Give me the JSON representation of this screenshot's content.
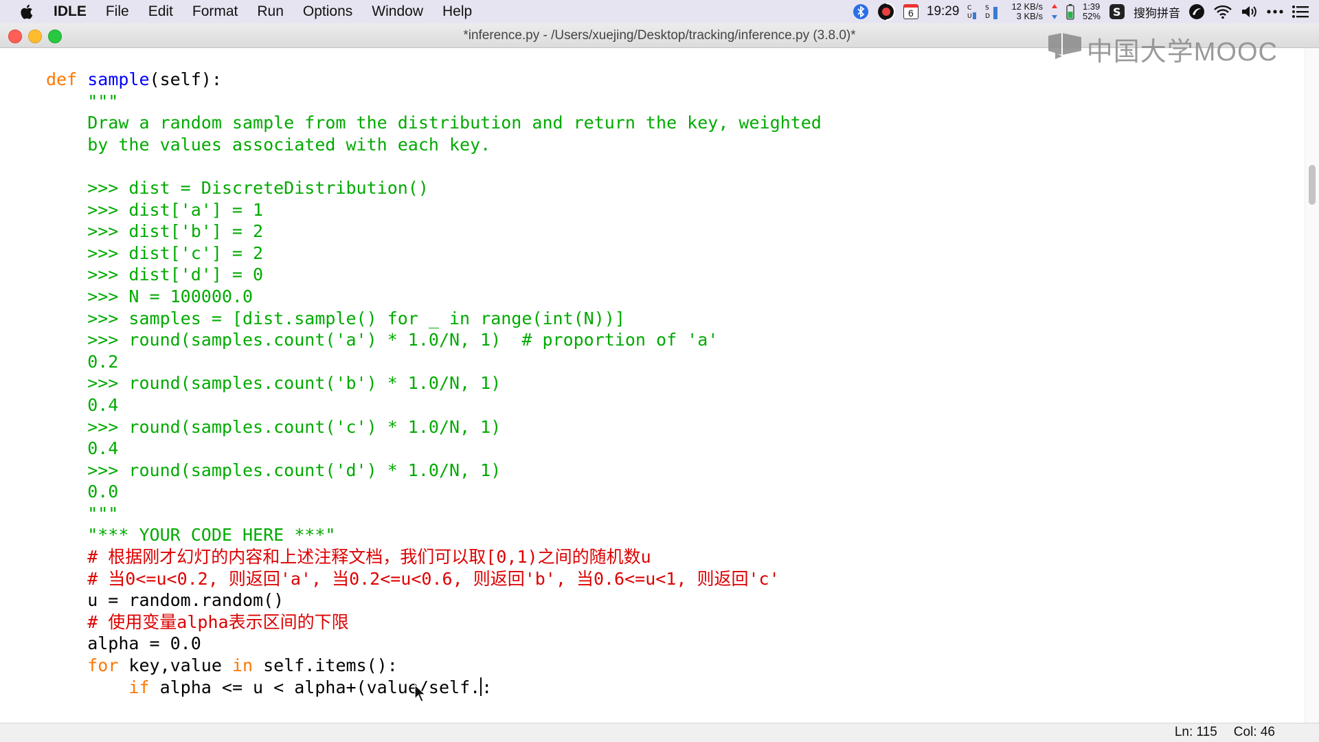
{
  "menubar": {
    "app_name": "IDLE",
    "items": [
      "File",
      "Edit",
      "Format",
      "Run",
      "Options",
      "Window",
      "Help"
    ],
    "status": {
      "calendar_day": "6",
      "time": "19:29",
      "net_up": "12 KB/s",
      "net_down": "3 KB/s",
      "battery_time": "1:39",
      "battery_percent": "52%",
      "input_method": "搜狗拼音",
      "icons": [
        "bluetooth-icon",
        "app-icon",
        "calendar-icon",
        "cpu-meter-icon",
        "disk-meter-icon",
        "battery-icon",
        "sogou-icon",
        "app2-icon",
        "wifi-icon",
        "volume-icon",
        "more-icon",
        "control-center-icon"
      ]
    }
  },
  "window": {
    "title": "*inference.py - /Users/xuejing/Desktop/tracking/inference.py (3.8.0)*"
  },
  "watermark": {
    "text": "中国大学MOOC"
  },
  "code": {
    "lines": [
      [
        {
          "t": "def ",
          "c": "kw"
        },
        {
          "t": "sample",
          "c": "def"
        },
        {
          "t": "(self):",
          "c": ""
        }
      ],
      [
        {
          "t": "    \"\"\"",
          "c": "str"
        }
      ],
      [
        {
          "t": "    Draw a random sample from the distribution and return the key, weighted",
          "c": "str"
        }
      ],
      [
        {
          "t": "    by the values associated with each key.",
          "c": "str"
        }
      ],
      [
        {
          "t": "",
          "c": "str"
        }
      ],
      [
        {
          "t": "    >>> dist = DiscreteDistribution()",
          "c": "str"
        }
      ],
      [
        {
          "t": "    >>> dist['a'] = 1",
          "c": "str"
        }
      ],
      [
        {
          "t": "    >>> dist['b'] = 2",
          "c": "str"
        }
      ],
      [
        {
          "t": "    >>> dist['c'] = 2",
          "c": "str"
        }
      ],
      [
        {
          "t": "    >>> dist['d'] = 0",
          "c": "str"
        }
      ],
      [
        {
          "t": "    >>> N = 100000.0",
          "c": "str"
        }
      ],
      [
        {
          "t": "    >>> samples = [dist.sample() for _ in range(int(N))]",
          "c": "str"
        }
      ],
      [
        {
          "t": "    >>> round(samples.count('a') * 1.0/N, 1)  # proportion of 'a'",
          "c": "str"
        }
      ],
      [
        {
          "t": "    0.2",
          "c": "str"
        }
      ],
      [
        {
          "t": "    >>> round(samples.count('b') * 1.0/N, 1)",
          "c": "str"
        }
      ],
      [
        {
          "t": "    0.4",
          "c": "str"
        }
      ],
      [
        {
          "t": "    >>> round(samples.count('c') * 1.0/N, 1)",
          "c": "str"
        }
      ],
      [
        {
          "t": "    0.4",
          "c": "str"
        }
      ],
      [
        {
          "t": "    >>> round(samples.count('d') * 1.0/N, 1)",
          "c": "str"
        }
      ],
      [
        {
          "t": "    0.0",
          "c": "str"
        }
      ],
      [
        {
          "t": "    \"\"\"",
          "c": "str"
        }
      ],
      [
        {
          "t": "    \"*** YOUR CODE HERE ***\"",
          "c": "str"
        }
      ],
      [
        {
          "t": "    # 根据刚才幻灯的内容和上述注释文档，我们可以取[0,1)之间的随机数u",
          "c": "cmt"
        }
      ],
      [
        {
          "t": "    # 当0<=u<0.2, 则返回'a', 当0.2<=u<0.6, 则返回'b', 当0.6<=u<1, 则返回'c'",
          "c": "cmt"
        }
      ],
      [
        {
          "t": "    u = random.random()",
          "c": ""
        }
      ],
      [
        {
          "t": "    # 使用变量alpha表示区间的下限",
          "c": "cmt"
        }
      ],
      [
        {
          "t": "    alpha = 0.0",
          "c": ""
        }
      ],
      [
        {
          "t": "    ",
          "c": ""
        },
        {
          "t": "for",
          "c": "kw"
        },
        {
          "t": " key,value ",
          "c": ""
        },
        {
          "t": "in",
          "c": "kw"
        },
        {
          "t": " self.items():",
          "c": ""
        }
      ],
      [
        {
          "t": "        ",
          "c": ""
        },
        {
          "t": "if",
          "c": "kw"
        },
        {
          "t": " alpha <= u < alpha+(value/self.",
          "c": ""
        },
        {
          "t": "",
          "c": "caret"
        },
        {
          "t": ":",
          "c": ""
        }
      ]
    ]
  },
  "statusbar": {
    "line": "Ln: 115",
    "col": "Col: 46"
  }
}
